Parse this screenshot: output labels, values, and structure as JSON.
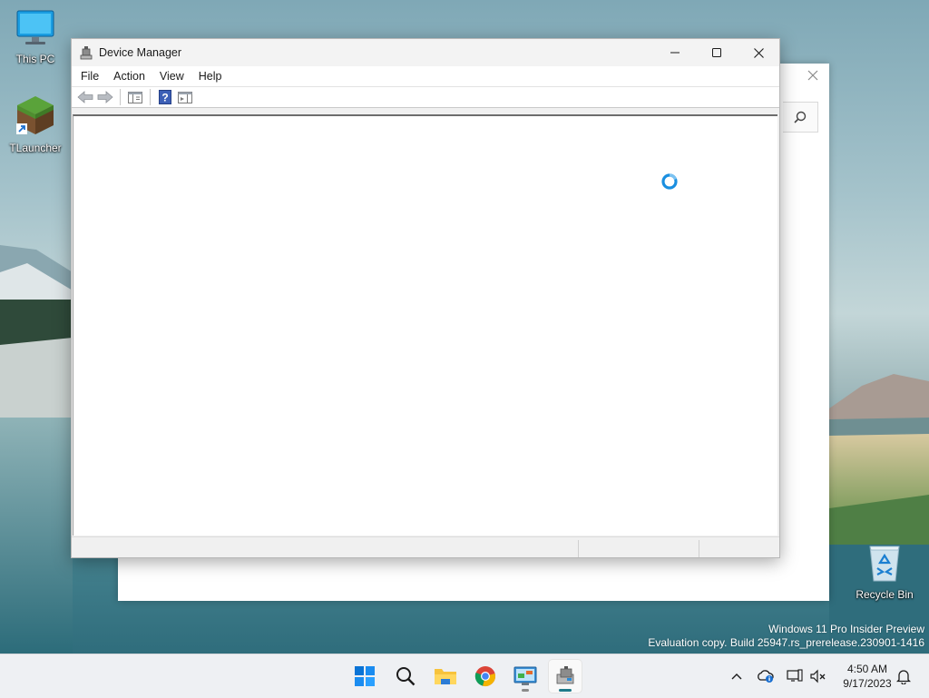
{
  "desktop": {
    "icons": [
      {
        "label": "This PC",
        "icon": "computer-icon"
      },
      {
        "label": "TLauncher",
        "icon": "minecraft-block-icon"
      },
      {
        "label": "Recycle Bin",
        "icon": "recycle-bin-icon"
      }
    ],
    "watermark": {
      "line1": "Windows 11 Pro Insider Preview",
      "line2": "Evaluation copy. Build 25947.rs_prerelease.230901-1416"
    }
  },
  "background_window": {
    "close_icon": "close-icon",
    "search_icon": "search-icon"
  },
  "device_manager": {
    "title": "Device Manager",
    "menu": [
      "File",
      "Action",
      "View",
      "Help"
    ],
    "toolbar": [
      "back-arrow-icon",
      "forward-arrow-icon",
      "console-tree-icon",
      "help-icon",
      "action-pane-icon"
    ],
    "status": "loading",
    "colors": {
      "spinner": "#1a8fe0"
    }
  },
  "taskbar": {
    "apps": [
      "start-icon",
      "search-icon",
      "file-explorer-icon",
      "chrome-icon",
      "control-panel-icon",
      "device-manager-icon"
    ],
    "clock": {
      "time": "4:50 AM",
      "date": "9/17/2023"
    }
  }
}
